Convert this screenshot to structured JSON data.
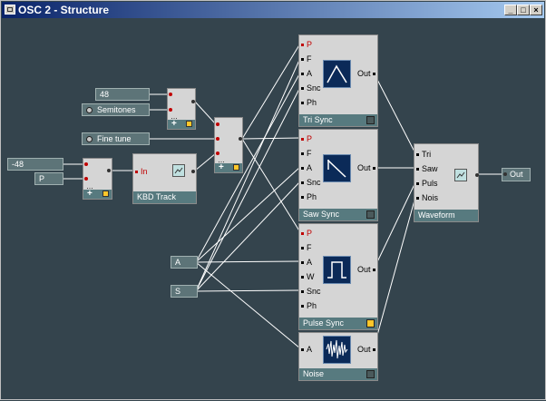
{
  "window": {
    "title": "OSC 2 - Structure"
  },
  "modules": {
    "tri_sync": {
      "name": "Tri Sync",
      "inputs": [
        "P",
        "F",
        "A",
        "Snc",
        "Ph"
      ],
      "output": "Out"
    },
    "saw_sync": {
      "name": "Saw Sync",
      "inputs": [
        "P",
        "F",
        "A",
        "Snc",
        "Ph"
      ],
      "output": "Out"
    },
    "pulse_sync": {
      "name": "Pulse Sync",
      "inputs": [
        "P",
        "F",
        "A",
        "W",
        "Snc",
        "Ph"
      ],
      "output": "Out"
    },
    "noise": {
      "name": "Noise",
      "inputs": [
        "A"
      ],
      "output": "Out"
    },
    "waveform": {
      "name": "Waveform",
      "inputs": [
        "Tri",
        "Saw",
        "Puls",
        "Nois"
      ]
    },
    "kbd_track": {
      "name": "KBD Track",
      "input": "In"
    }
  },
  "controls": {
    "value_48": "48",
    "semitones": "Semitones",
    "fine_tune": "Fine tune",
    "value_neg48": "-48",
    "p_box": "P",
    "a_box": "A",
    "s_box": "S",
    "out_box": "Out"
  },
  "colors": {
    "background": "#34444d",
    "module_body": "#d5d5d5",
    "module_bar": "#577a7f",
    "led_on": "#ffc72a",
    "display": "#0b2a58"
  }
}
